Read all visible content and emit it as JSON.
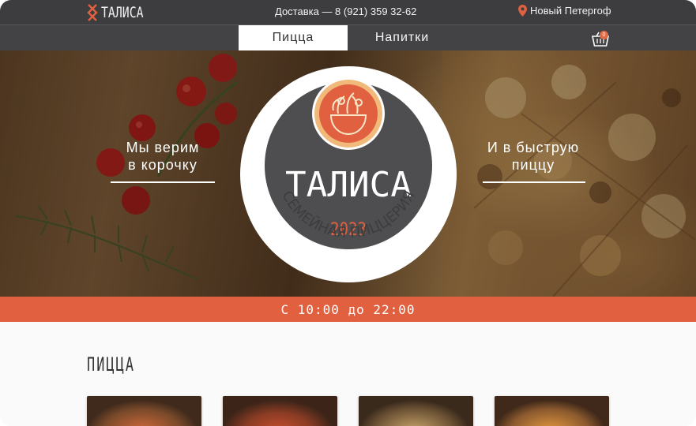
{
  "header": {
    "logo_text": "ТАЛИСА",
    "delivery": "Доставка — 8 (921) 359 32-62",
    "location": "Новый Петергоф"
  },
  "nav": {
    "tabs": [
      {
        "label": "Пицца",
        "active": true
      },
      {
        "label": "Напитки",
        "active": false
      }
    ],
    "cart_count": "0"
  },
  "hero": {
    "left_text_1": "Мы верим",
    "left_text_2": "в корочку",
    "right_text_1": "И в быструю",
    "right_text_2": "пиццу",
    "emblem": {
      "title": "ТАЛИСА",
      "year": "2023",
      "subtitle": "СЕМЕЙНАЯ ПИЦЦЕРИЯ"
    }
  },
  "hours": "С 10:00 до 22:00",
  "section": {
    "title": "ПИЦЦА"
  },
  "colors": {
    "accent": "#e0603f",
    "dark": "#3d3d3f",
    "emblem_grey": "#4e4e50"
  }
}
